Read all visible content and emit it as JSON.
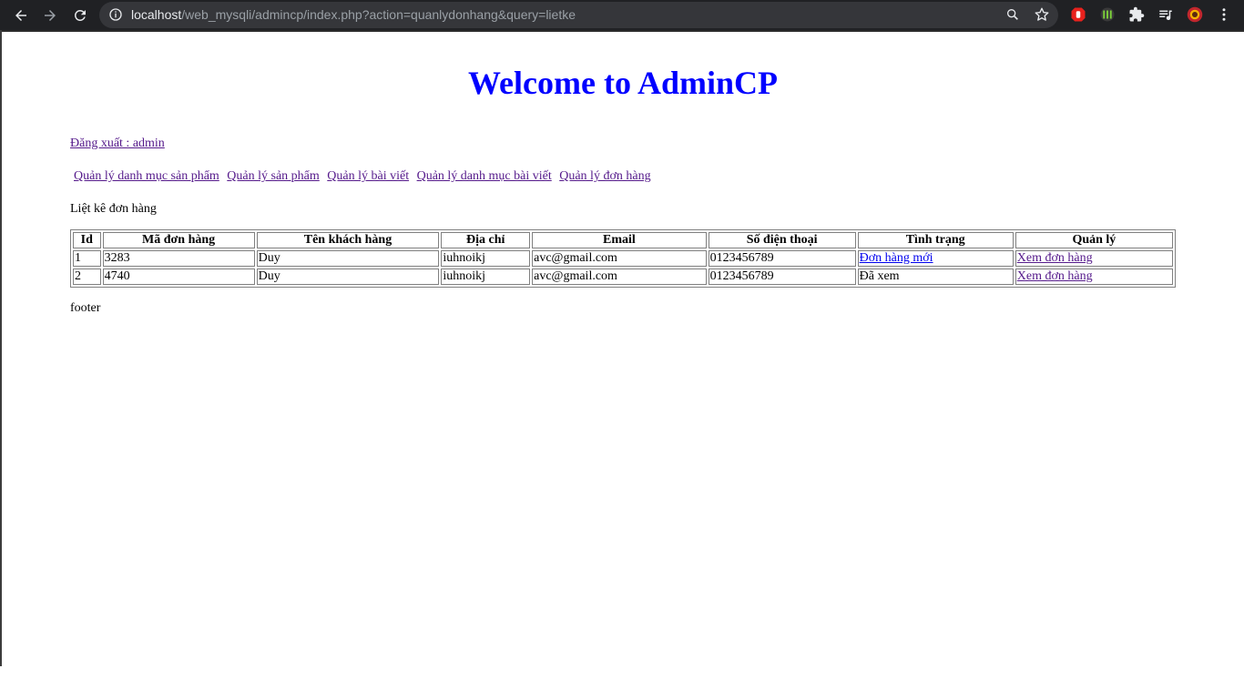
{
  "browser": {
    "url_host": "localhost",
    "url_path": "/web_mysqli/admincp/index.php?action=quanlydonhang&query=lietke",
    "icons": [
      "back-icon",
      "forward-icon",
      "reload-icon",
      "info-icon",
      "zoom-icon",
      "star-icon",
      "adblock-extension-icon",
      "monster-extension-icon",
      "puzzle-icon",
      "media-queue-icon",
      "profile-avatar-icon",
      "menu-dots-icon"
    ]
  },
  "page": {
    "title": "Welcome to AdminCP",
    "title_color": "#0000ff",
    "logout_link": "Đăng xuất : admin",
    "menu": [
      "Quản lý danh mục sản phẩm",
      "Quản lý sản phẩm",
      "Quản lý bài viết",
      "Quản lý danh mục bài viết",
      "Quản lý đơn hàng"
    ],
    "section_title": "Liệt kê đơn hàng",
    "table": {
      "headers": [
        "Id",
        "Mã đơn hàng",
        "Tên khách hàng",
        "Địa chỉ",
        "Email",
        "Số điện thoại",
        "Tình trạng",
        "Quản lý"
      ],
      "rows": [
        {
          "id": "1",
          "code": "3283",
          "customer": "Duy",
          "address": "iuhnoikj",
          "email": "avc@gmail.com",
          "phone": "0123456789",
          "status": "Đơn hàng mới",
          "status_is_link": true,
          "action": "Xem đơn hàng"
        },
        {
          "id": "2",
          "code": "4740",
          "customer": "Duy",
          "address": "iuhnoikj",
          "email": "avc@gmail.com",
          "phone": "0123456789",
          "status": "Đã xem",
          "status_is_link": false,
          "action": "Xem đơn hàng"
        }
      ]
    },
    "footer": "footer"
  }
}
